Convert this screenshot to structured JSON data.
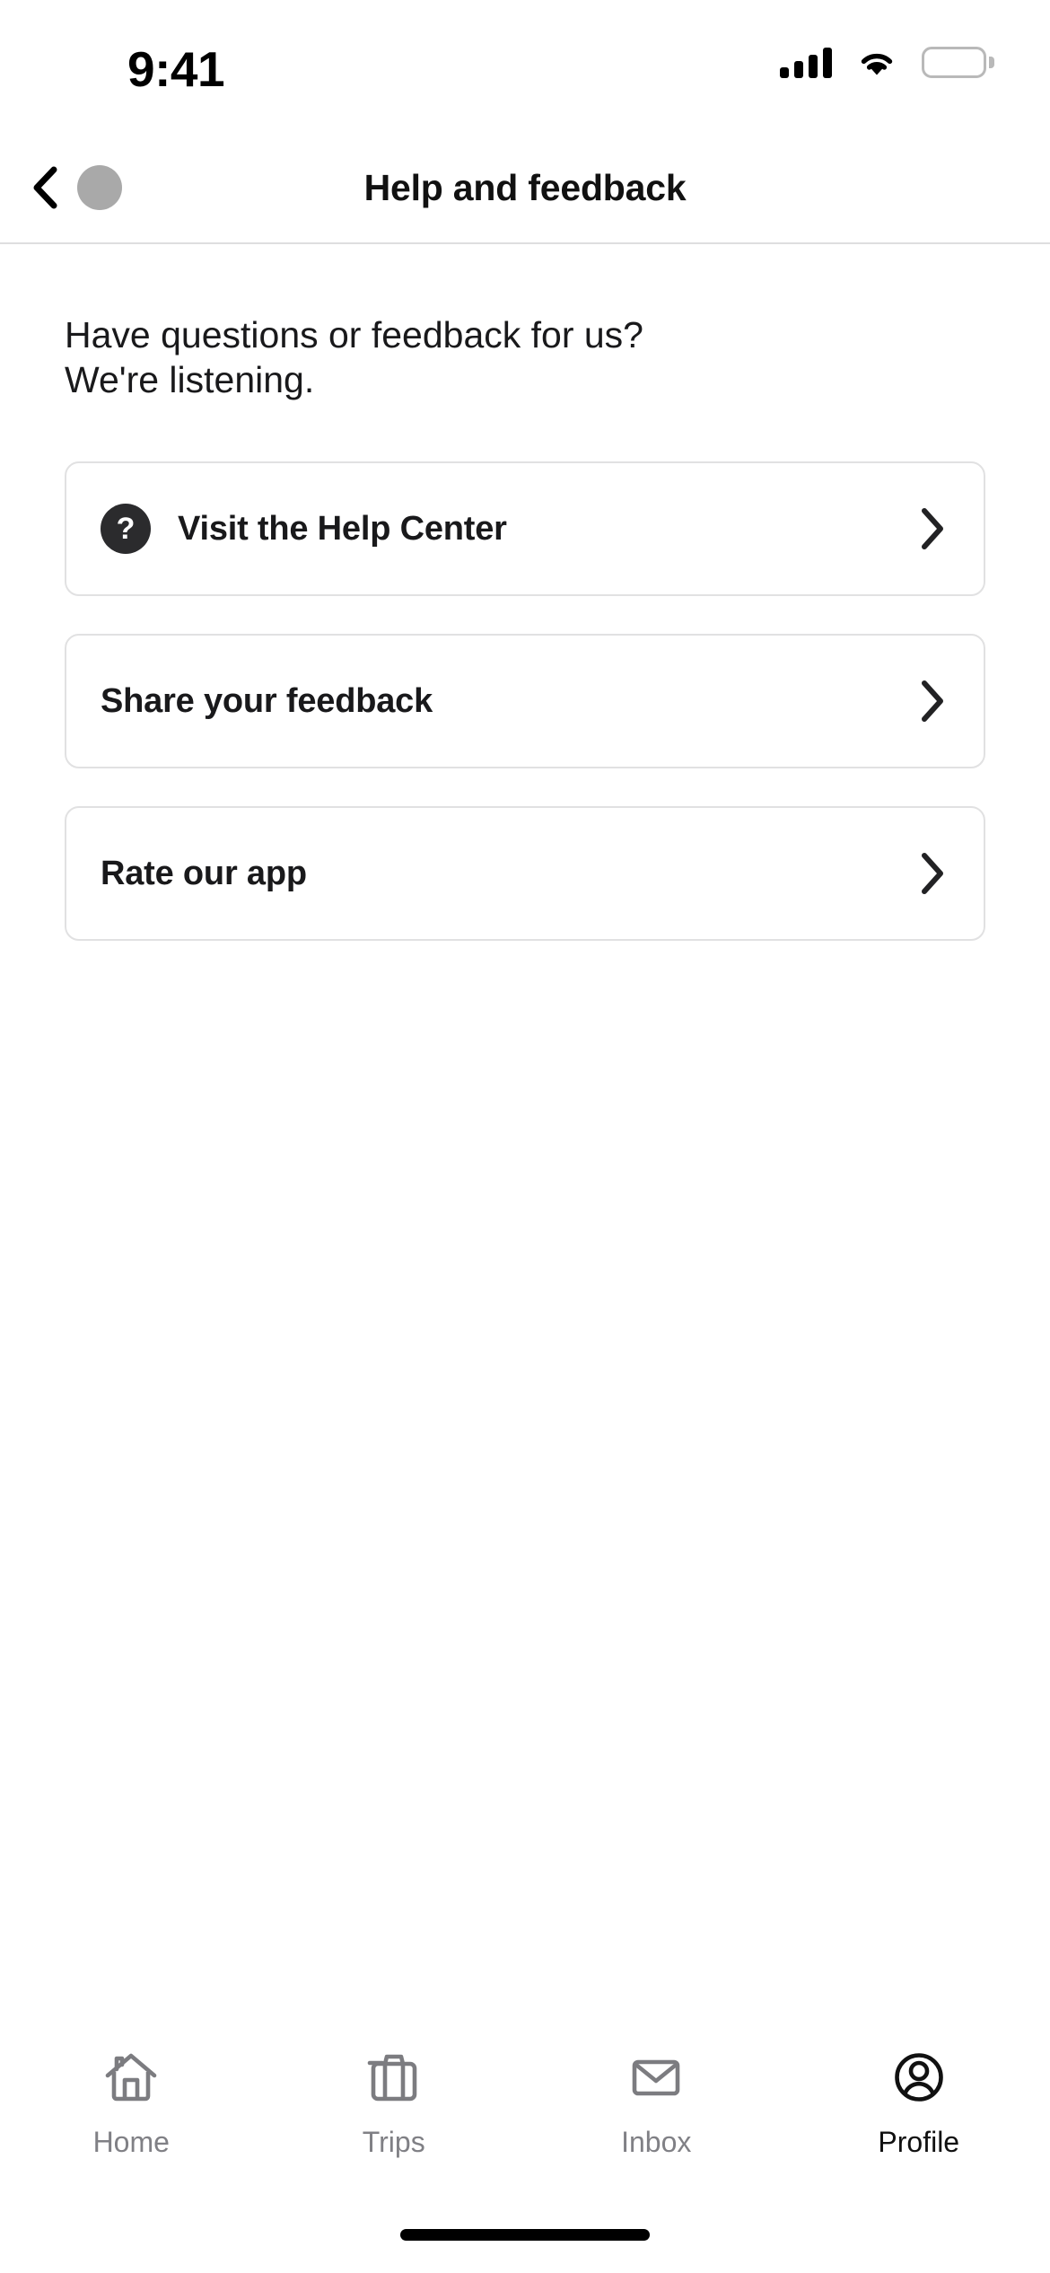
{
  "status_bar": {
    "time": "9:41",
    "signal_icon": "cellular-signal-icon",
    "wifi_icon": "wifi-icon",
    "battery_icon": "battery-full-icon"
  },
  "header": {
    "back_icon": "chevron-left-icon",
    "avatar": "avatar-placeholder",
    "title": "Help and feedback"
  },
  "main": {
    "intro": "Have questions or feedback for us?\nWe're listening.",
    "cards": [
      {
        "label": "Visit the Help Center",
        "icon": "question-mark-circle-icon",
        "icon_glyph": "?",
        "chevron": "chevron-right-icon"
      },
      {
        "label": "Share your feedback",
        "icon": null,
        "chevron": "chevron-right-icon"
      },
      {
        "label": "Rate our app",
        "icon": null,
        "chevron": "chevron-right-icon"
      }
    ]
  },
  "tab_bar": {
    "items": [
      {
        "label": "Home",
        "icon": "house-icon",
        "active": false
      },
      {
        "label": "Trips",
        "icon": "suitcase-icon",
        "active": false
      },
      {
        "label": "Inbox",
        "icon": "envelope-icon",
        "active": false
      },
      {
        "label": "Profile",
        "icon": "person-circle-icon",
        "active": true
      }
    ]
  },
  "colors": {
    "background": "#ffffff",
    "text_primary": "#19191b",
    "text_muted": "#808085",
    "border": "#e1e1e2",
    "header_border": "#dededf",
    "icon_badge": "#2b2b2d",
    "avatar": "#a9a9a9",
    "tab_inactive": "#7c7c80",
    "tab_active": "#111111"
  }
}
